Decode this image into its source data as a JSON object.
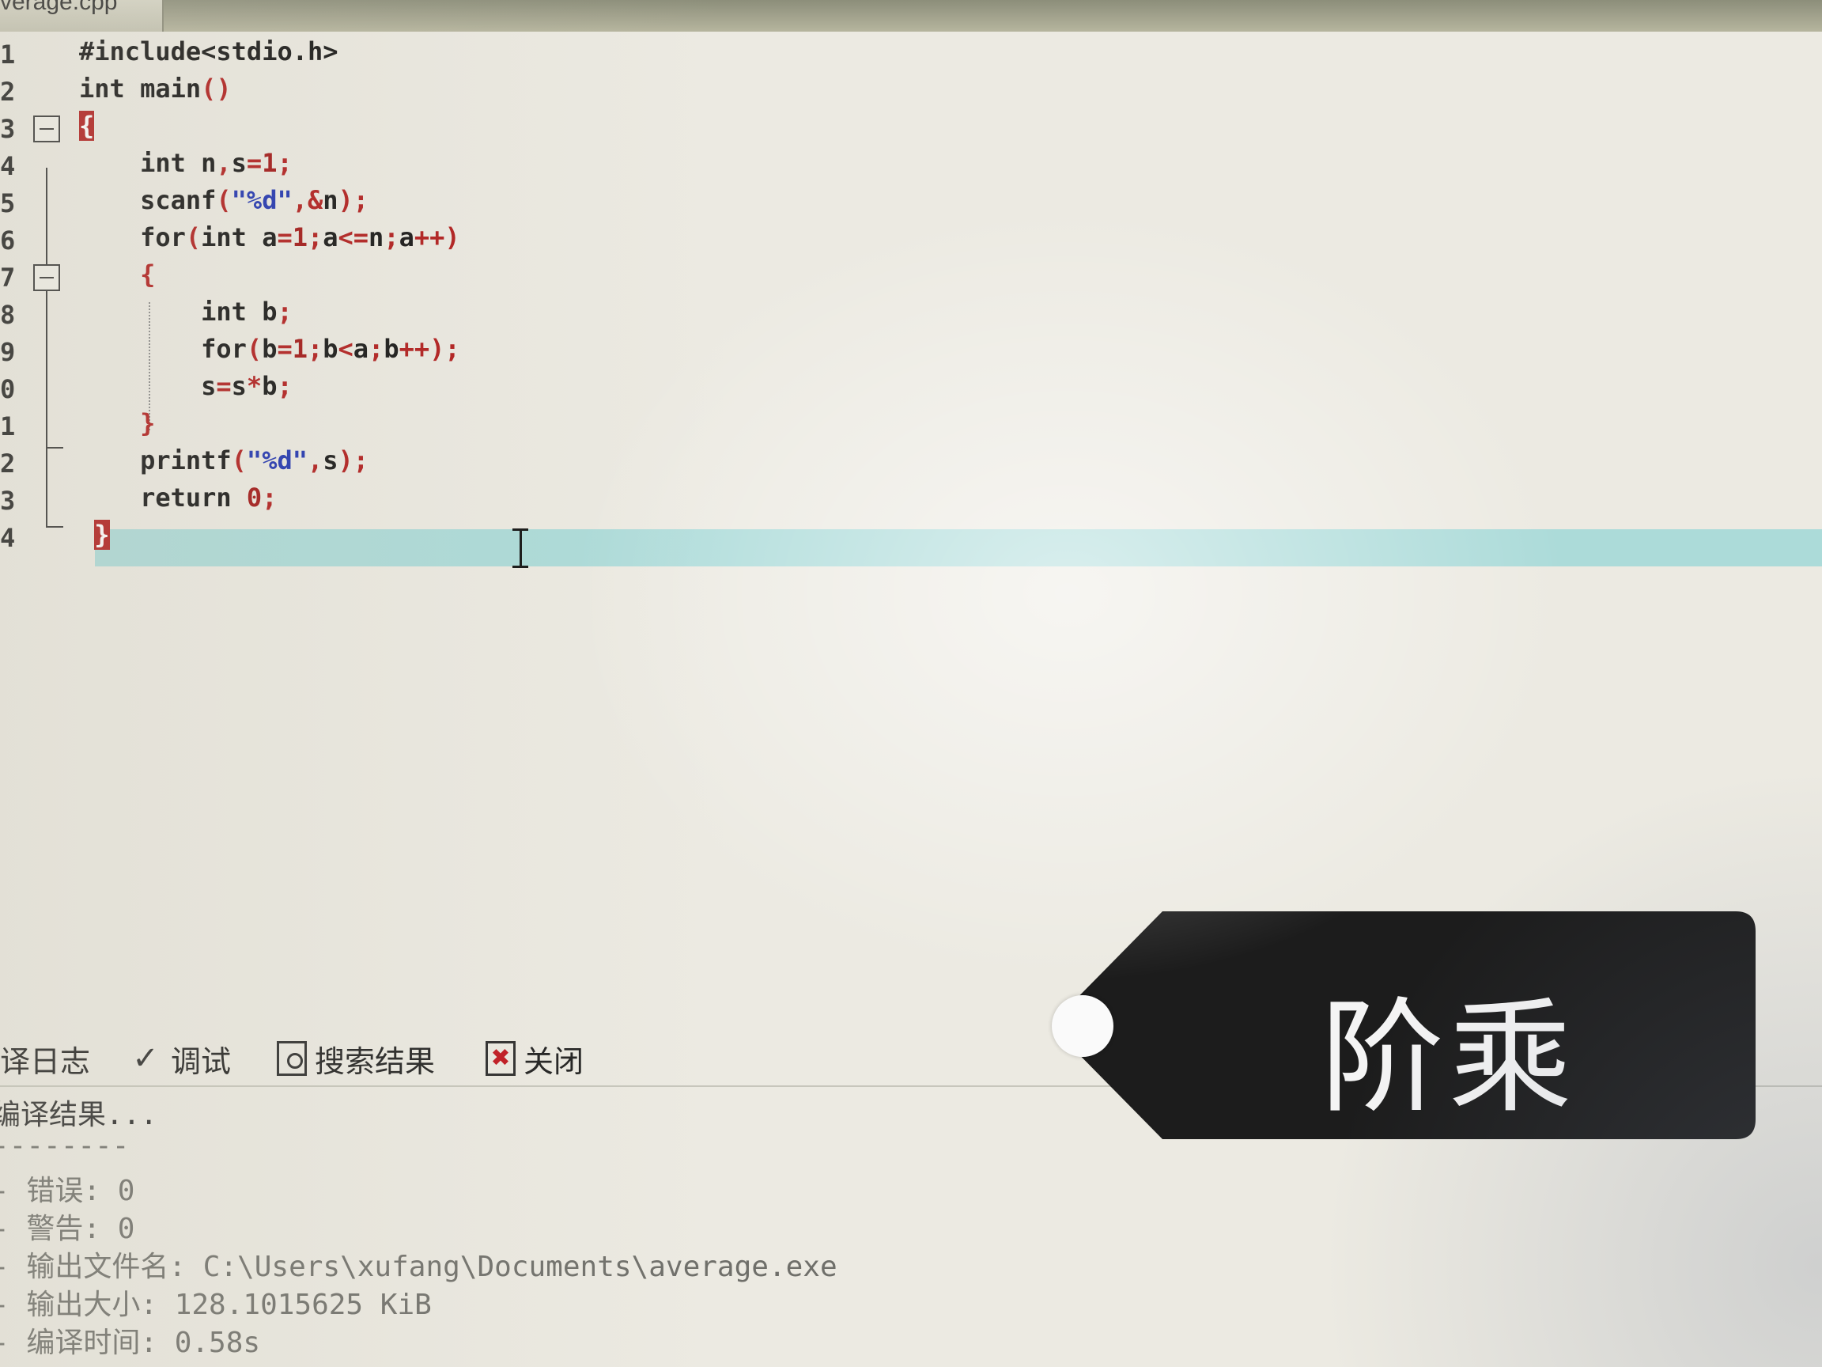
{
  "tab": {
    "filename": "verage.cpp"
  },
  "gutter": [
    "1",
    "2",
    "3",
    "4",
    "5",
    "6",
    "7",
    "8",
    "9",
    "0",
    "1",
    "2",
    "3",
    "4"
  ],
  "code": [
    [
      {
        "t": "#include<stdio.h>",
        "c": "kw"
      }
    ],
    [
      {
        "t": "int main",
        "c": "kw"
      },
      {
        "t": "()",
        "c": "sym"
      }
    ],
    [
      {
        "t": "{",
        "c": "brace-hl"
      }
    ],
    [
      {
        "t": "    int n",
        "c": "kw"
      },
      {
        "t": ",",
        "c": "sym"
      },
      {
        "t": "s",
        "c": "kw"
      },
      {
        "t": "=",
        "c": "sym"
      },
      {
        "t": "1",
        "c": "num"
      },
      {
        "t": ";",
        "c": "sym"
      }
    ],
    [
      {
        "t": "    scanf",
        "c": "kw"
      },
      {
        "t": "(",
        "c": "sym"
      },
      {
        "t": "\"%d\"",
        "c": "str"
      },
      {
        "t": ",&",
        "c": "sym"
      },
      {
        "t": "n",
        "c": "kw"
      },
      {
        "t": ");",
        "c": "sym"
      }
    ],
    [
      {
        "t": "    for",
        "c": "kw"
      },
      {
        "t": "(",
        "c": "sym"
      },
      {
        "t": "int a",
        "c": "kw"
      },
      {
        "t": "=",
        "c": "sym"
      },
      {
        "t": "1",
        "c": "num"
      },
      {
        "t": ";",
        "c": "sym"
      },
      {
        "t": "a",
        "c": "kw"
      },
      {
        "t": "<=",
        "c": "sym"
      },
      {
        "t": "n",
        "c": "kw"
      },
      {
        "t": ";",
        "c": "sym"
      },
      {
        "t": "a",
        "c": "kw"
      },
      {
        "t": "++)",
        "c": "sym"
      }
    ],
    [
      {
        "t": "    {",
        "c": "sym"
      }
    ],
    [
      {
        "t": "        int b",
        "c": "kw"
      },
      {
        "t": ";",
        "c": "sym"
      }
    ],
    [
      {
        "t": "        for",
        "c": "kw"
      },
      {
        "t": "(",
        "c": "sym"
      },
      {
        "t": "b",
        "c": "kw"
      },
      {
        "t": "=",
        "c": "sym"
      },
      {
        "t": "1",
        "c": "num"
      },
      {
        "t": ";",
        "c": "sym"
      },
      {
        "t": "b",
        "c": "kw"
      },
      {
        "t": "<",
        "c": "sym"
      },
      {
        "t": "a",
        "c": "kw"
      },
      {
        "t": ";",
        "c": "sym"
      },
      {
        "t": "b",
        "c": "kw"
      },
      {
        "t": "++);",
        "c": "sym"
      }
    ],
    [
      {
        "t": "        s",
        "c": "kw"
      },
      {
        "t": "=",
        "c": "sym"
      },
      {
        "t": "s",
        "c": "kw"
      },
      {
        "t": "*",
        "c": "sym"
      },
      {
        "t": "b",
        "c": "kw"
      },
      {
        "t": ";",
        "c": "sym"
      }
    ],
    [
      {
        "t": "    }",
        "c": "sym"
      }
    ],
    [
      {
        "t": "    printf",
        "c": "kw"
      },
      {
        "t": "(",
        "c": "sym"
      },
      {
        "t": "\"%d\"",
        "c": "str"
      },
      {
        "t": ",",
        "c": "sym"
      },
      {
        "t": "s",
        "c": "kw"
      },
      {
        "t": ");",
        "c": "sym"
      }
    ],
    [
      {
        "t": "    return ",
        "c": "kw"
      },
      {
        "t": "0",
        "c": "num"
      },
      {
        "t": ";",
        "c": "sym"
      }
    ],
    [
      {
        "t": " ",
        "c": "kw"
      },
      {
        "t": "}",
        "c": "brace-hl"
      }
    ]
  ],
  "bottom_tabs": {
    "compile_log": "译日志",
    "debug": "调试",
    "search_results": "搜索结果",
    "close": "关闭"
  },
  "log": {
    "header": "编译结果...",
    "separator": "--------",
    "errors": "- 错误: 0",
    "warnings": "- 警告: 0",
    "output_file": "- 输出文件名: C:\\Users\\xufang\\Documents\\average.exe",
    "output_size": "- 输出大小: 128.1015625 KiB",
    "compile_time": "- 编译时间: 0.58s"
  },
  "overlay": {
    "label": "阶乘"
  },
  "colors": {
    "keyword": "#111111",
    "symbol": "#b01818",
    "string": "#1a2fb0",
    "current_line": "#78cdd2"
  }
}
